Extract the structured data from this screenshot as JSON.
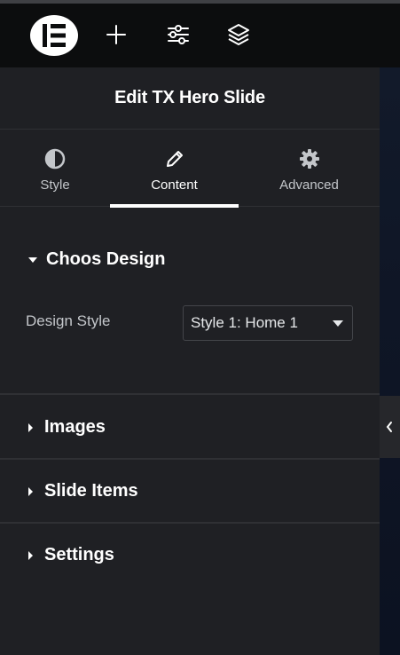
{
  "topbar": {
    "logo_icon": "elementor-logo-icon",
    "buttons": [
      {
        "icon": "plus-icon"
      },
      {
        "icon": "sliders-icon"
      },
      {
        "icon": "layers-icon"
      }
    ]
  },
  "panel": {
    "title": "Edit TX Hero Slide",
    "tabs": [
      {
        "label": "Style",
        "icon": "half-circle-icon",
        "active": false
      },
      {
        "label": "Content",
        "icon": "pencil-icon",
        "active": true
      },
      {
        "label": "Advanced",
        "icon": "gear-icon",
        "active": false
      }
    ],
    "sections": {
      "design": {
        "title": "Choos Design",
        "control_label": "Design Style",
        "select_value": "Style 1: Home 1"
      },
      "images": {
        "title": "Images"
      },
      "slide_items": {
        "title": "Slide Items"
      },
      "settings": {
        "title": "Settings"
      }
    }
  },
  "colors": {
    "panel_bg": "#1f2024",
    "topbar_bg": "#0c0d0e",
    "divider": "#2f3034",
    "text_primary": "#ffffff",
    "text_secondary": "#c3c6ca"
  }
}
